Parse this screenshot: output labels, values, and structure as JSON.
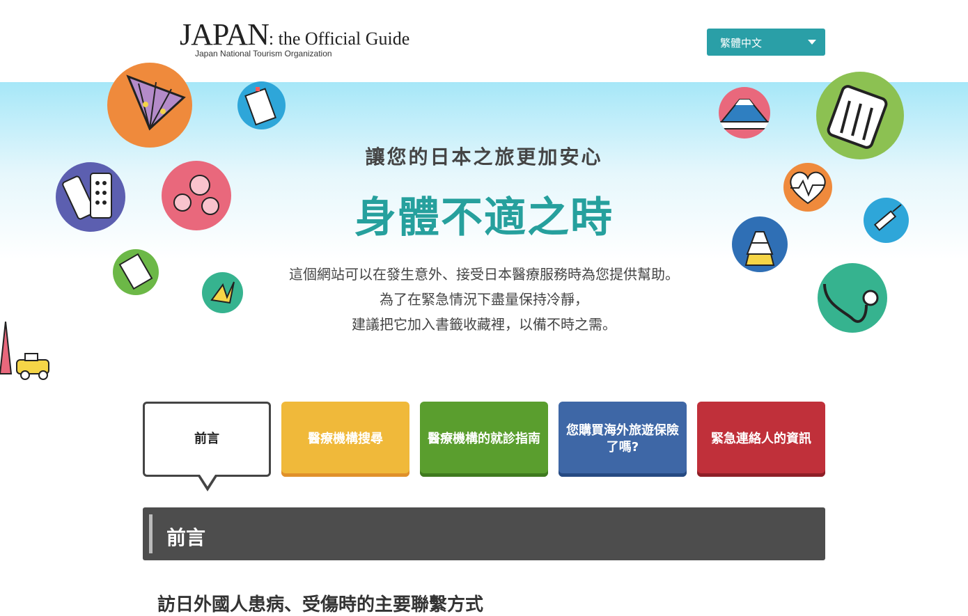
{
  "header": {
    "logo_main": "JAPAN",
    "logo_guide": ": the Official Guide",
    "logo_sub": "Japan National Tourism Organization",
    "language": "繁體中文"
  },
  "hero": {
    "subtitle": "讓您的日本之旅更加安心",
    "title": "身體不適之時",
    "desc": [
      "這個網站可以在發生意外、接受日本醫療服務時為您提供幫助。",
      "為了在緊急情況下盡量保持冷靜，",
      "建議把它加入書籤收藏裡，以備不時之需。"
    ]
  },
  "tabs": [
    {
      "label": "前言",
      "color": "#ffffff",
      "active": true
    },
    {
      "label": "醫療機構搜尋",
      "color": "#f0b93a"
    },
    {
      "label": "醫療機構的就診指南",
      "color": "#5a9e2e"
    },
    {
      "label": "您購買海外旅遊保險了嗎?",
      "color": "#3e67a6"
    },
    {
      "label": "緊急連絡人的資訊",
      "color": "#c0303a"
    }
  ],
  "section": {
    "title": "前言"
  },
  "subheading": "訪日外國人患病、受傷時的主要聯繫方式",
  "colors": {
    "teal": "#26a09d",
    "lang_bg": "#2a9fa7",
    "dark_bar": "#4d4d4d"
  }
}
